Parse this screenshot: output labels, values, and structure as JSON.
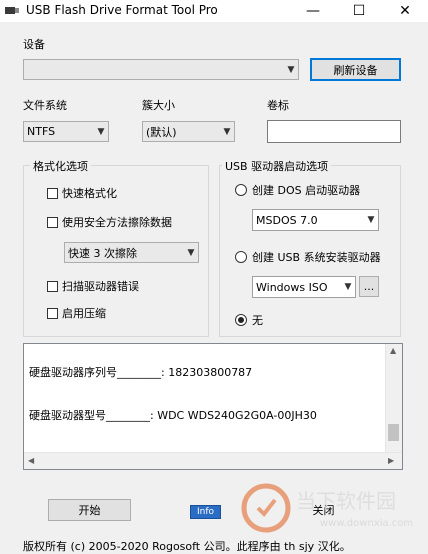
{
  "window": {
    "title": "USB Flash Drive Format Tool Pro",
    "minimize_glyph": "—",
    "maximize_glyph": "☐",
    "close_glyph": "✕"
  },
  "device": {
    "label": "设备",
    "selected": "",
    "refresh_label": "刷新设备"
  },
  "filesystem": {
    "label": "文件系统",
    "selected": "NTFS"
  },
  "cluster": {
    "label": "簇大小",
    "selected": "(默认)"
  },
  "volume": {
    "label": "卷标",
    "value": ""
  },
  "format_options": {
    "title": "格式化选项",
    "quick_format": "快速格式化",
    "secure_erase": "使用安全方法擦除数据",
    "erase_method": "快速 3 次擦除",
    "scan_errors": "扫描驱动器错误",
    "enable_compression": "启用压缩"
  },
  "boot_options": {
    "title": "USB 驱动器启动选项",
    "dos_boot": "创建 DOS 启动驱动器",
    "dos_version": "MSDOS 7.0",
    "usb_installer": "创建 USB 系统安装驱动器",
    "windows_source": "Windows ISO",
    "browse_label": "...",
    "none_label": "无",
    "selected": "none"
  },
  "log": {
    "lines": [
      "硬盘驱动器序列号________: 182303800787",
      "硬盘驱动器型号________: WDC WDS240G2G0A-00JH30"
    ]
  },
  "buttons": {
    "start": "开始",
    "info": "Info",
    "close": "关闭"
  },
  "footer": {
    "copyright": "版权所有 (c) 2005-2020 Rogosoft 公司。此程序由 th sjy 汉化。"
  },
  "watermark": {
    "brand": "当下软件园",
    "url": "www.downxia.com"
  },
  "colors": {
    "accent": "#0078d7",
    "info_badge": "#2b6cc4",
    "watermark": "#e0601c"
  }
}
